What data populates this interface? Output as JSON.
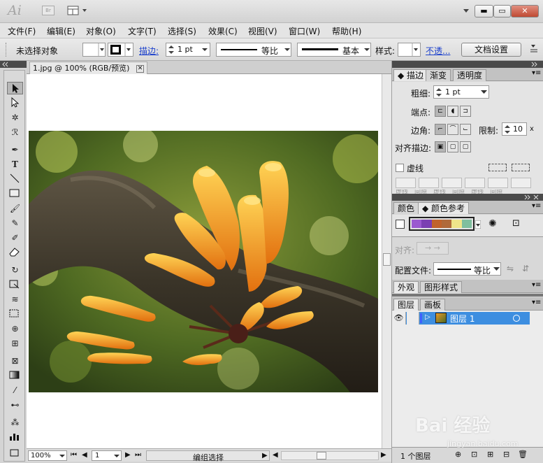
{
  "app": {
    "logo": "Ai",
    "bridge": "Br"
  },
  "window": {
    "minimize": "▬",
    "restore": "▭",
    "close": "✕"
  },
  "menus": [
    "文件(F)",
    "编辑(E)",
    "对象(O)",
    "文字(T)",
    "选择(S)",
    "效果(C)",
    "视图(V)",
    "窗口(W)",
    "帮助(H)"
  ],
  "options": {
    "selection": "未选择对象",
    "stroke_link": "描边:",
    "stroke_weight": "1 pt",
    "profile": "等比",
    "brush": "基本",
    "style_label": "样式:",
    "opacity_link": "不透...",
    "doc_setup": "文档设置"
  },
  "document": {
    "tab_title": "1.jpg @ 100% (RGB/预览)",
    "zoom": "100%",
    "page": "1",
    "status": "编组选择"
  },
  "stroke_panel": {
    "tabs": [
      "描边",
      "渐变",
      "透明度"
    ],
    "weight_label": "粗细:",
    "weight_value": "1 pt",
    "cap_label": "端点:",
    "corner_label": "边角:",
    "limit_label": "限制:",
    "limit_value": "10",
    "limit_unit": "x",
    "align_label": "对齐描边:",
    "dashed_label": "虚线",
    "extra_labels": [
      "虚线",
      "间隙",
      "虚线",
      "间隙",
      "虚线",
      "间隙"
    ],
    "arrows_label": "对齐:",
    "profile_label": "配置文件:",
    "profile_value": "等比"
  },
  "color_panel": {
    "tabs": [
      "颜色",
      "颜色参考"
    ],
    "swatches": [
      "#9b59d0",
      "#7b3fb2",
      "#c0632c",
      "#b06a3a",
      "#efe58a",
      "#7fbf9e"
    ]
  },
  "appearance_panel": {
    "tabs": [
      "外观",
      "图形样式"
    ]
  },
  "layers_panel": {
    "tabs": [
      "图层",
      "画板"
    ],
    "layer_name": "图层 1",
    "count": "1 个图层"
  },
  "watermark": {
    "logo": "Bai 经验",
    "url": "jingyan.baidu.com"
  }
}
